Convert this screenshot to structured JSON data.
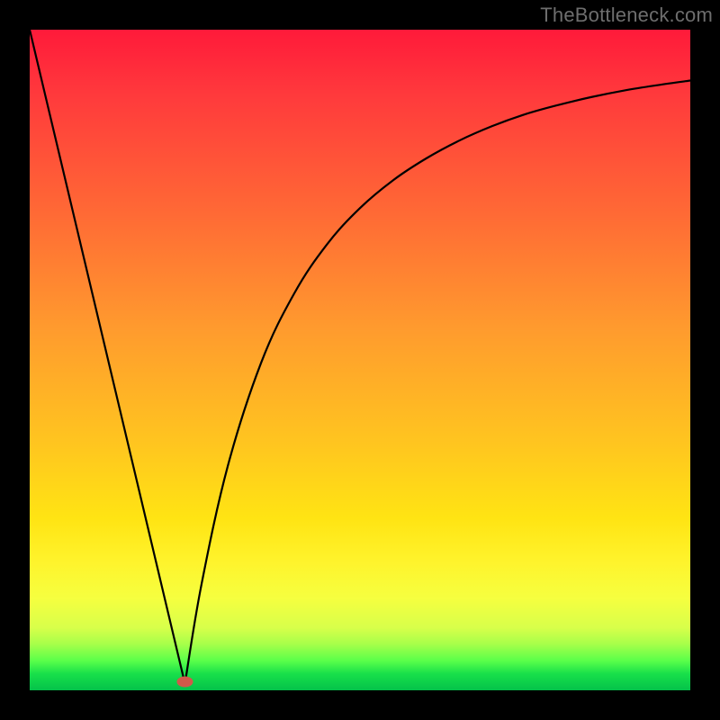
{
  "watermark": "TheBottleneck.com",
  "marker": {
    "cx_frac": 0.235,
    "cy_frac": 0.987,
    "color": "#d05a4a",
    "rx": 9,
    "ry": 6
  },
  "chart_data": {
    "type": "line",
    "title": "",
    "xlabel": "",
    "ylabel": "",
    "xlim": [
      0,
      100
    ],
    "ylim": [
      0,
      100
    ],
    "series": [
      {
        "name": "left-descent",
        "x": [
          0,
          23.5
        ],
        "values": [
          100,
          1
        ]
      },
      {
        "name": "right-ascent",
        "x": [
          23.5,
          26,
          30,
          35,
          40,
          45,
          50,
          55,
          60,
          65,
          70,
          75,
          80,
          85,
          90,
          95,
          100
        ],
        "values": [
          1,
          16,
          34,
          49.5,
          60,
          67.5,
          73,
          77.2,
          80.5,
          83.2,
          85.4,
          87.2,
          88.6,
          89.8,
          90.8,
          91.6,
          92.3
        ]
      }
    ],
    "annotations": [
      {
        "name": "marker",
        "x": 23.5,
        "y": 1.3,
        "shape": "ellipse",
        "color": "#d05a4a"
      }
    ]
  }
}
